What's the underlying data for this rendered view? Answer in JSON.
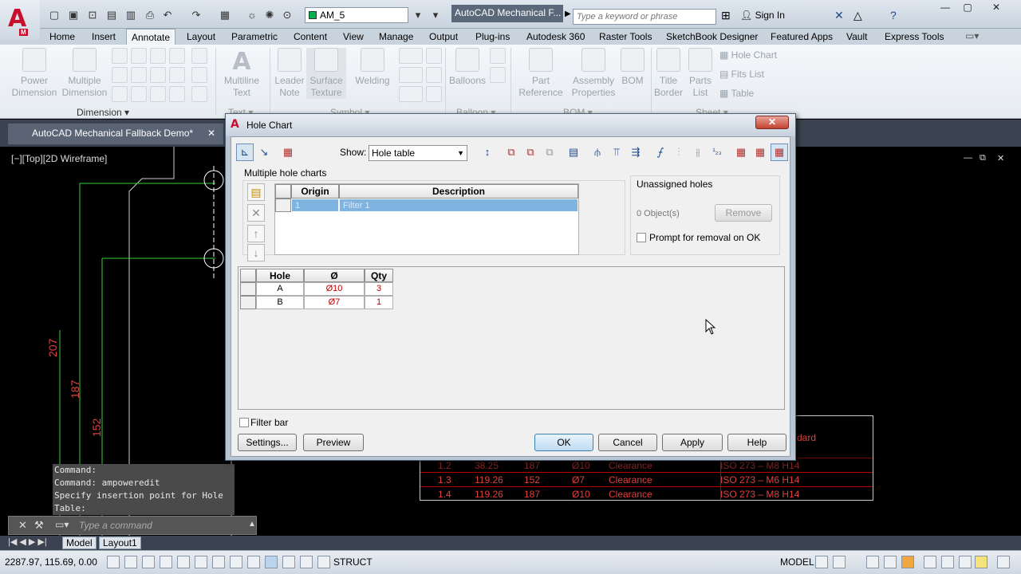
{
  "app": {
    "logo_letter": "A",
    "logo_sub": "M",
    "workspace": "AM_5",
    "title": "AutoCAD Mechanical F...",
    "search_placeholder": "Type a keyword or phrase",
    "sign_in": "Sign In"
  },
  "ribbon": {
    "tabs": [
      "Home",
      "Insert",
      "Annotate",
      "Layout",
      "Parametric",
      "Content",
      "View",
      "Manage",
      "Output",
      "Plug-ins",
      "Autodesk 360",
      "Raster Tools",
      "SketchBook Designer",
      "Featured Apps",
      "Vault",
      "Express Tools"
    ],
    "active_tab": "Annotate",
    "buttons": {
      "power_dimension": "Power\nDimension",
      "multiple_dimension": "Multiple\nDimension",
      "multiline_text": "Multiline\nText",
      "leader_note": "Leader\nNote",
      "surface_texture": "Surface\nTexture",
      "welding": "Welding",
      "balloons": "Balloons",
      "part_reference": "Part\nReference",
      "assembly_properties": "Assembly\nProperties",
      "bom": "BOM",
      "title_border": "Title\nBorder",
      "parts_list": "Parts\nList"
    },
    "list_items": [
      "Hole Chart",
      "Fits List",
      "Table"
    ],
    "panels": {
      "dimension": "Dimension",
      "text": "Text",
      "symbol": "Symbol",
      "balloon": "Balloon",
      "bom": "BOM",
      "sheet": "Sheet"
    }
  },
  "document": {
    "tab": "AutoCAD Mechanical Fallback Demo*",
    "view_label": "[−][Top][2D Wireframe]"
  },
  "drawing": {
    "dims": [
      "207",
      "187",
      "152"
    ],
    "bg_table": {
      "header_fragment": "dard",
      "rows": [
        [
          "1.2",
          "38.25",
          "187",
          "Ø10",
          "Clearance",
          "ISO 273 – M8  H14"
        ],
        [
          "1.3",
          "119.26",
          "152",
          "Ø7",
          "Clearance",
          "ISO 273 – M6  H14"
        ],
        [
          "1.4",
          "119.26",
          "187",
          "Ø10",
          "Clearance",
          "ISO 273 – M8  H14"
        ]
      ]
    }
  },
  "command": {
    "history": [
      "Command:",
      "Command: ampoweredit",
      "Specify insertion point for Hole",
      "Table:"
    ],
    "placeholder": "Type a command"
  },
  "layouts": [
    "Model",
    "Layout1"
  ],
  "status": {
    "coords": "2287.97, 115.69, 0.00",
    "struct": "STRUCT",
    "model": "MODEL"
  },
  "dialog": {
    "title": "Hole Chart",
    "close": "✕",
    "show_label": "Show:",
    "show_value": "Hole table",
    "multiple_hole_charts": "Multiple hole charts",
    "charts_grid": {
      "columns": [
        "Origin",
        "Description"
      ],
      "rows": [
        [
          "1",
          "Filter 1"
        ]
      ]
    },
    "unassigned_holes": "Unassigned holes",
    "objects_count": "0 Object(s)",
    "remove": "Remove",
    "prompt_removal": "Prompt for removal on OK",
    "holes_grid": {
      "columns": [
        "Hole",
        "Ø",
        "Qty"
      ],
      "rows": [
        [
          "A",
          "Ø10",
          "3"
        ],
        [
          "B",
          "Ø7",
          "1"
        ]
      ]
    },
    "filter_bar": "Filter bar",
    "buttons": {
      "settings": "Settings...",
      "preview": "Preview",
      "ok": "OK",
      "cancel": "Cancel",
      "apply": "Apply",
      "help": "Help"
    }
  },
  "colors": {
    "accent_red": "#c8102e",
    "drawing_bg": "#000000",
    "dim_red": "#e04040",
    "line_green": "#39d039"
  }
}
